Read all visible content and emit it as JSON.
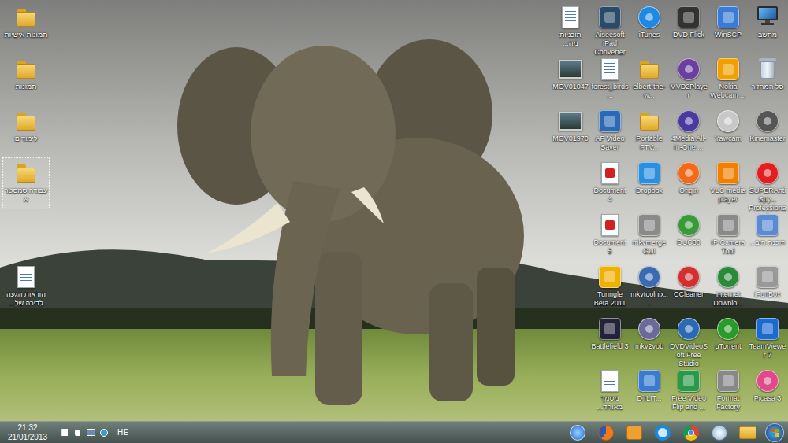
{
  "desktop": {
    "left_icons": [
      {
        "label": "תמונות אישיות",
        "selected": false
      },
      {
        "label": "תמונות",
        "selected": false
      },
      {
        "label": "לימודים",
        "selected": false
      },
      {
        "label": "עבודה סמסטר א",
        "selected": true
      }
    ],
    "left_bottom_icons": [
      {
        "label": "הוראות הגעה לדירה של...",
        "selected": false
      }
    ],
    "right_rows": [
      {
        "icons": [
          {
            "label": "תוכניות מה...",
            "selected": false
          },
          {
            "label": "Aiseesoft iPad Converter ...",
            "selected": false
          },
          {
            "label": "iTunes",
            "selected": false
          },
          {
            "label": "DVD Flick",
            "selected": false
          },
          {
            "label": "WinSCP",
            "selected": false
          },
          {
            "label": "מחשב",
            "selected": false
          }
        ]
      },
      {
        "icons": [
          {
            "label": "MOV01047",
            "selected": false
          },
          {
            "label": "forest_birds...",
            "selected": false
          },
          {
            "label": "elbert-the-w...",
            "selected": false
          },
          {
            "label": "MVD2Player",
            "selected": false
          },
          {
            "label": "Nokia Webcam ...",
            "selected": false
          },
          {
            "label": "סל המחזור",
            "selected": false
          }
        ]
      },
      {
        "icons": [
          {
            "label": "MOV01970",
            "selected": false
          },
          {
            "label": "AF Video Saver",
            "selected": false
          },
          {
            "label": "Portable FTV...",
            "selected": false
          },
          {
            "label": "4Media All-In-One ...",
            "selected": false
          },
          {
            "label": "Yawcam",
            "selected": false
          },
          {
            "label": "Kinemaster",
            "selected": false
          }
        ]
      },
      {
        "icons": [
          {
            "label": "Document 4",
            "selected": false
          },
          {
            "label": "Dropbox",
            "selected": false
          },
          {
            "label": "Origin",
            "selected": false
          },
          {
            "label": "VLC media player",
            "selected": false
          },
          {
            "label": "SUPERAntiSpy... Professional",
            "selected": false
          }
        ]
      },
      {
        "icons": [
          {
            "label": "Document 5",
            "selected": false
          },
          {
            "label": "mkvmerge GUI",
            "selected": false
          },
          {
            "label": "DUC30",
            "selected": false
          },
          {
            "label": "IP Camera Tool",
            "selected": false
          },
          {
            "label": "תוכנת חיב...",
            "selected": false
          }
        ]
      },
      {
        "icons": [
          {
            "label": "Tunngle Beta 2011",
            "selected": false
          },
          {
            "label": "mkvtoolnix...",
            "selected": false
          },
          {
            "label": "CCleaner",
            "selected": false
          },
          {
            "label": "Internet Downlo...",
            "selected": false
          },
          {
            "label": "iFunBox",
            "selected": false
          }
        ]
      },
      {
        "icons": [
          {
            "label": "Battlefield 3",
            "selected": false
          },
          {
            "label": "mkv2vob",
            "selected": false
          },
          {
            "label": "DVDVideoSoft Free Studio",
            "selected": false
          },
          {
            "label": "µTorrent",
            "selected": false
          },
          {
            "label": "TeamViewer 7",
            "selected": false
          }
        ]
      },
      {
        "icons": [
          {
            "label": "מסמך מאוחד...",
            "selected": false
          },
          {
            "label": "DirLIT...",
            "selected": false
          },
          {
            "label": "Free Video Flip and ...",
            "selected": false
          },
          {
            "label": "Format Factory",
            "selected": false
          },
          {
            "label": "Picasa 3",
            "selected": false
          }
        ]
      }
    ]
  },
  "taskbar": {
    "clock": {
      "time": "21:32",
      "date": "21/01/2013"
    },
    "language": "HE"
  }
}
